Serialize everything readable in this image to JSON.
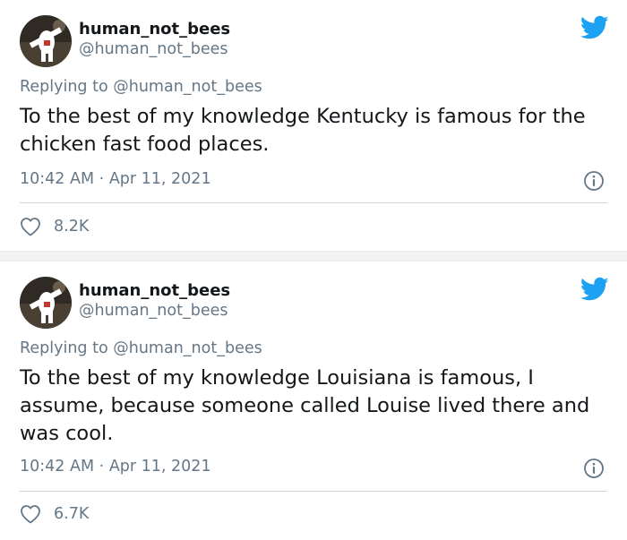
{
  "tweets": [
    {
      "author": {
        "display_name": "human_not_bees",
        "handle": "@human_not_bees"
      },
      "replying_label": "Replying to",
      "replying_to": "@human_not_bees",
      "text": "To the best of my knowledge Kentucky is famous for the chicken fast food places.",
      "time": "10:42 AM",
      "separator": "·",
      "date": "Apr 11, 2021",
      "likes": "8.2K"
    },
    {
      "author": {
        "display_name": "human_not_bees",
        "handle": "@human_not_bees"
      },
      "replying_label": "Replying to",
      "replying_to": "@human_not_bees",
      "text": "To the best of my knowledge Louisiana is famous, I assume, because someone called Louise lived there and was cool.",
      "time": "10:42 AM",
      "separator": "·",
      "date": "Apr 11, 2021",
      "likes": "6.7K"
    }
  ],
  "icons": {
    "brand": "twitter-bird-icon",
    "info": "info-icon",
    "like": "heart-icon"
  },
  "colors": {
    "brand": "#1da1f2",
    "text": "#14171a",
    "muted": "#657786",
    "divider": "#ccd6dd"
  }
}
